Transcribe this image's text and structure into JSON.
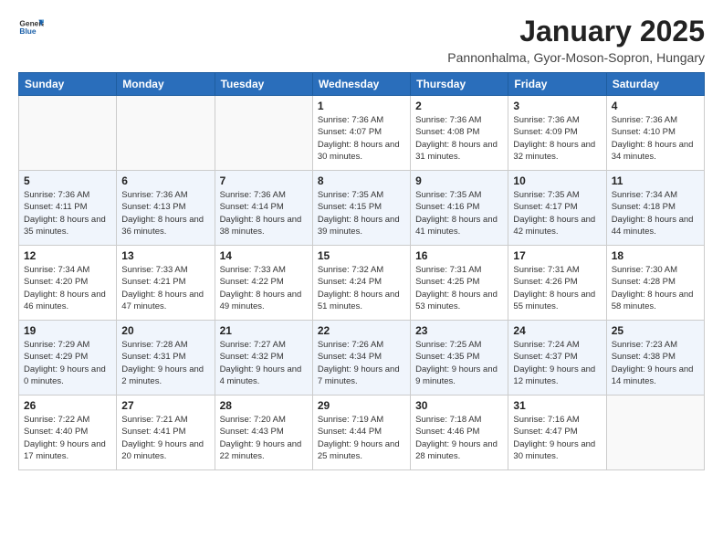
{
  "header": {
    "logo_general": "General",
    "logo_blue": "Blue",
    "title": "January 2025",
    "subtitle": "Pannonhalma, Gyor-Moson-Sopron, Hungary"
  },
  "weekdays": [
    "Sunday",
    "Monday",
    "Tuesday",
    "Wednesday",
    "Thursday",
    "Friday",
    "Saturday"
  ],
  "weeks": [
    [
      {
        "day": "",
        "detail": ""
      },
      {
        "day": "",
        "detail": ""
      },
      {
        "day": "",
        "detail": ""
      },
      {
        "day": "1",
        "detail": "Sunrise: 7:36 AM\nSunset: 4:07 PM\nDaylight: 8 hours\nand 30 minutes."
      },
      {
        "day": "2",
        "detail": "Sunrise: 7:36 AM\nSunset: 4:08 PM\nDaylight: 8 hours\nand 31 minutes."
      },
      {
        "day": "3",
        "detail": "Sunrise: 7:36 AM\nSunset: 4:09 PM\nDaylight: 8 hours\nand 32 minutes."
      },
      {
        "day": "4",
        "detail": "Sunrise: 7:36 AM\nSunset: 4:10 PM\nDaylight: 8 hours\nand 34 minutes."
      }
    ],
    [
      {
        "day": "5",
        "detail": "Sunrise: 7:36 AM\nSunset: 4:11 PM\nDaylight: 8 hours\nand 35 minutes."
      },
      {
        "day": "6",
        "detail": "Sunrise: 7:36 AM\nSunset: 4:13 PM\nDaylight: 8 hours\nand 36 minutes."
      },
      {
        "day": "7",
        "detail": "Sunrise: 7:36 AM\nSunset: 4:14 PM\nDaylight: 8 hours\nand 38 minutes."
      },
      {
        "day": "8",
        "detail": "Sunrise: 7:35 AM\nSunset: 4:15 PM\nDaylight: 8 hours\nand 39 minutes."
      },
      {
        "day": "9",
        "detail": "Sunrise: 7:35 AM\nSunset: 4:16 PM\nDaylight: 8 hours\nand 41 minutes."
      },
      {
        "day": "10",
        "detail": "Sunrise: 7:35 AM\nSunset: 4:17 PM\nDaylight: 8 hours\nand 42 minutes."
      },
      {
        "day": "11",
        "detail": "Sunrise: 7:34 AM\nSunset: 4:18 PM\nDaylight: 8 hours\nand 44 minutes."
      }
    ],
    [
      {
        "day": "12",
        "detail": "Sunrise: 7:34 AM\nSunset: 4:20 PM\nDaylight: 8 hours\nand 46 minutes."
      },
      {
        "day": "13",
        "detail": "Sunrise: 7:33 AM\nSunset: 4:21 PM\nDaylight: 8 hours\nand 47 minutes."
      },
      {
        "day": "14",
        "detail": "Sunrise: 7:33 AM\nSunset: 4:22 PM\nDaylight: 8 hours\nand 49 minutes."
      },
      {
        "day": "15",
        "detail": "Sunrise: 7:32 AM\nSunset: 4:24 PM\nDaylight: 8 hours\nand 51 minutes."
      },
      {
        "day": "16",
        "detail": "Sunrise: 7:31 AM\nSunset: 4:25 PM\nDaylight: 8 hours\nand 53 minutes."
      },
      {
        "day": "17",
        "detail": "Sunrise: 7:31 AM\nSunset: 4:26 PM\nDaylight: 8 hours\nand 55 minutes."
      },
      {
        "day": "18",
        "detail": "Sunrise: 7:30 AM\nSunset: 4:28 PM\nDaylight: 8 hours\nand 58 minutes."
      }
    ],
    [
      {
        "day": "19",
        "detail": "Sunrise: 7:29 AM\nSunset: 4:29 PM\nDaylight: 9 hours\nand 0 minutes."
      },
      {
        "day": "20",
        "detail": "Sunrise: 7:28 AM\nSunset: 4:31 PM\nDaylight: 9 hours\nand 2 minutes."
      },
      {
        "day": "21",
        "detail": "Sunrise: 7:27 AM\nSunset: 4:32 PM\nDaylight: 9 hours\nand 4 minutes."
      },
      {
        "day": "22",
        "detail": "Sunrise: 7:26 AM\nSunset: 4:34 PM\nDaylight: 9 hours\nand 7 minutes."
      },
      {
        "day": "23",
        "detail": "Sunrise: 7:25 AM\nSunset: 4:35 PM\nDaylight: 9 hours\nand 9 minutes."
      },
      {
        "day": "24",
        "detail": "Sunrise: 7:24 AM\nSunset: 4:37 PM\nDaylight: 9 hours\nand 12 minutes."
      },
      {
        "day": "25",
        "detail": "Sunrise: 7:23 AM\nSunset: 4:38 PM\nDaylight: 9 hours\nand 14 minutes."
      }
    ],
    [
      {
        "day": "26",
        "detail": "Sunrise: 7:22 AM\nSunset: 4:40 PM\nDaylight: 9 hours\nand 17 minutes."
      },
      {
        "day": "27",
        "detail": "Sunrise: 7:21 AM\nSunset: 4:41 PM\nDaylight: 9 hours\nand 20 minutes."
      },
      {
        "day": "28",
        "detail": "Sunrise: 7:20 AM\nSunset: 4:43 PM\nDaylight: 9 hours\nand 22 minutes."
      },
      {
        "day": "29",
        "detail": "Sunrise: 7:19 AM\nSunset: 4:44 PM\nDaylight: 9 hours\nand 25 minutes."
      },
      {
        "day": "30",
        "detail": "Sunrise: 7:18 AM\nSunset: 4:46 PM\nDaylight: 9 hours\nand 28 minutes."
      },
      {
        "day": "31",
        "detail": "Sunrise: 7:16 AM\nSunset: 4:47 PM\nDaylight: 9 hours\nand 30 minutes."
      },
      {
        "day": "",
        "detail": ""
      }
    ]
  ]
}
